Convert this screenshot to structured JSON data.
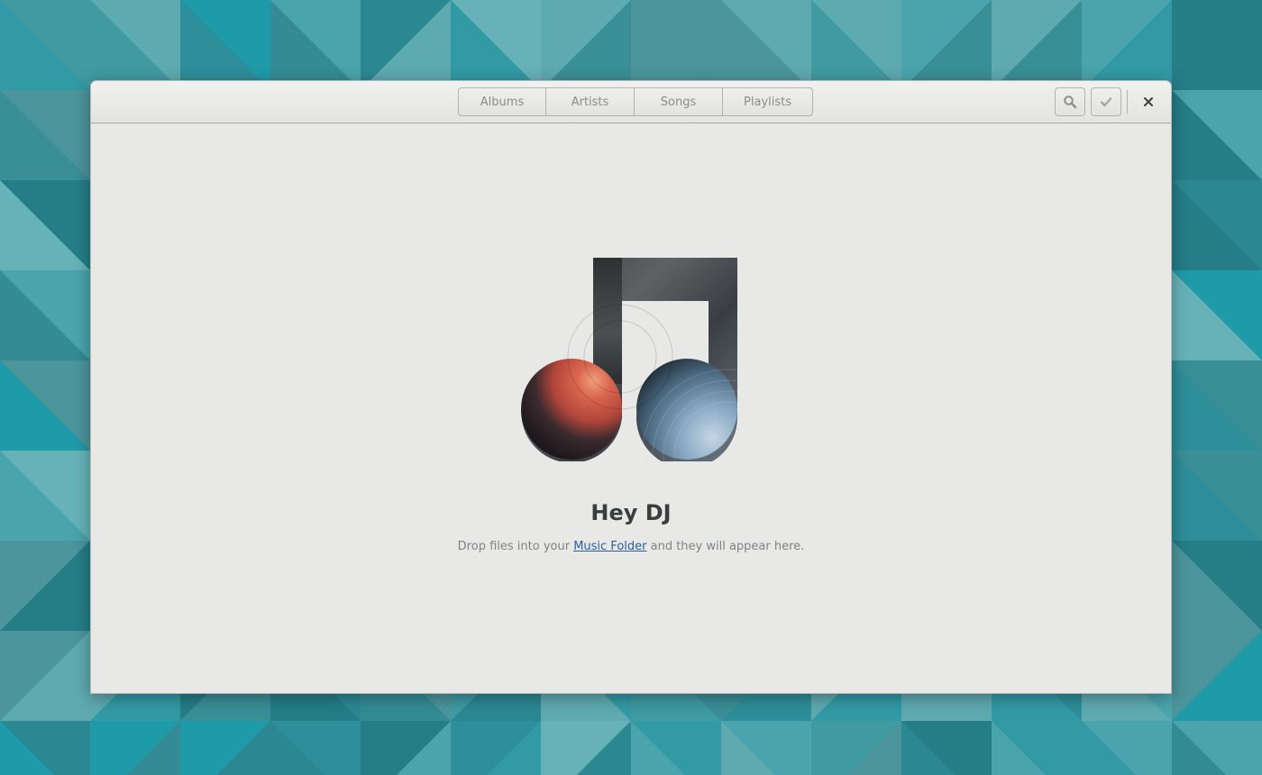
{
  "header": {
    "tabs": [
      {
        "label": "Albums"
      },
      {
        "label": "Artists"
      },
      {
        "label": "Songs"
      },
      {
        "label": "Playlists"
      }
    ],
    "search_icon": "search-icon",
    "select_icon": "checkmark-icon",
    "close_icon": "close-icon"
  },
  "empty_state": {
    "icon": "music-note-icon",
    "title": "Hey DJ",
    "description_before": "Drop files into your ",
    "link_text": "Music Folder",
    "description_after": " and they will appear here."
  },
  "colors": {
    "wallpaper": "#2f8e99",
    "window_bg": "#e8e8e7",
    "link": "#2a5c9c",
    "title_text": "#3b3d3e"
  }
}
